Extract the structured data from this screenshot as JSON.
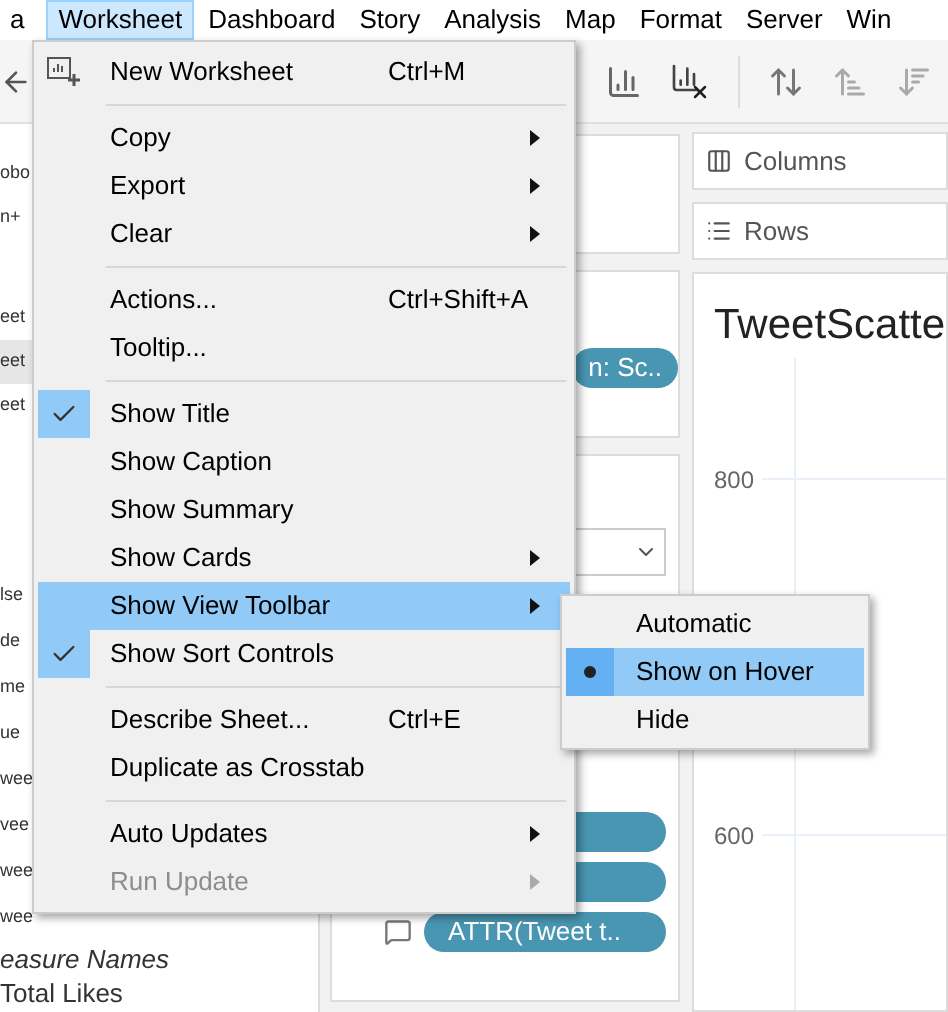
{
  "menubar": [
    {
      "label": "a",
      "selected": false
    },
    {
      "label": "Worksheet",
      "selected": true
    },
    {
      "label": "Dashboard",
      "selected": false
    },
    {
      "label": "Story",
      "selected": false
    },
    {
      "label": "Analysis",
      "selected": false
    },
    {
      "label": "Map",
      "selected": false
    },
    {
      "label": "Format",
      "selected": false
    },
    {
      "label": "Server",
      "selected": false
    },
    {
      "label": "Win",
      "selected": false
    }
  ],
  "data_pane": {
    "items_top": [
      {
        "label": "obo",
        "selected": false
      },
      {
        "label": "n+",
        "selected": false
      },
      {
        "label": "eet",
        "selected": false
      },
      {
        "label": "eet",
        "selected": true
      },
      {
        "label": "eet",
        "selected": false
      }
    ],
    "fields": [
      "lse",
      "de",
      "me",
      "ue",
      "wee",
      "vee",
      "wee",
      "wee"
    ],
    "fields_below": [
      {
        "label": "easure Names",
        "italic": true
      },
      {
        "label": "Total Likes",
        "italic": false
      }
    ]
  },
  "cards": {
    "filter_pill": "n: Sc..",
    "marks_pills": [
      {
        "kind": "plain"
      },
      {
        "kind": "plain"
      },
      {
        "label": "ATTR(Tweet t..",
        "kind": "tooltip"
      }
    ]
  },
  "shelves": [
    {
      "label": "Columns",
      "kind": "columns"
    },
    {
      "label": "Rows",
      "kind": "rows"
    }
  ],
  "view": {
    "title": "TweetScatte",
    "yticks": [
      "800",
      "600"
    ]
  },
  "menu": {
    "sections": [
      [
        {
          "label": "New Worksheet",
          "shortcut": "Ctrl+M",
          "submenu": false,
          "checked": false,
          "selected": false,
          "disabled": false,
          "kind": "new"
        }
      ],
      [
        {
          "label": "Copy",
          "submenu": true,
          "checked": false,
          "selected": false,
          "disabled": false
        },
        {
          "label": "Export",
          "submenu": true,
          "checked": false,
          "selected": false,
          "disabled": false
        },
        {
          "label": "Clear",
          "submenu": true,
          "checked": false,
          "selected": false,
          "disabled": false
        }
      ],
      [
        {
          "label": "Actions...",
          "shortcut": "Ctrl+Shift+A",
          "submenu": false,
          "checked": false,
          "selected": false,
          "disabled": false
        },
        {
          "label": "Tooltip...",
          "submenu": false,
          "checked": false,
          "selected": false,
          "disabled": false
        }
      ],
      [
        {
          "label": "Show Title",
          "submenu": false,
          "checked": true,
          "selected": false,
          "disabled": false
        },
        {
          "label": "Show Caption",
          "submenu": false,
          "checked": false,
          "selected": false,
          "disabled": false
        },
        {
          "label": "Show Summary",
          "submenu": false,
          "checked": false,
          "selected": false,
          "disabled": false
        },
        {
          "label": "Show Cards",
          "submenu": true,
          "checked": false,
          "selected": false,
          "disabled": false
        },
        {
          "label": "Show View Toolbar",
          "submenu": true,
          "checked": false,
          "selected": true,
          "disabled": false
        },
        {
          "label": "Show Sort Controls",
          "submenu": false,
          "checked": true,
          "selected": false,
          "disabled": false
        }
      ],
      [
        {
          "label": "Describe Sheet...",
          "shortcut": "Ctrl+E",
          "submenu": false,
          "checked": false,
          "selected": false,
          "disabled": false
        },
        {
          "label": "Duplicate as Crosstab",
          "submenu": false,
          "checked": false,
          "selected": false,
          "disabled": false
        }
      ],
      [
        {
          "label": "Auto Updates",
          "submenu": true,
          "checked": false,
          "selected": false,
          "disabled": false
        },
        {
          "label": "Run Update",
          "submenu": true,
          "checked": false,
          "selected": false,
          "disabled": true
        }
      ]
    ]
  },
  "submenu": [
    {
      "label": "Automatic",
      "selected": false,
      "highlighted": false
    },
    {
      "label": "Show on Hover",
      "selected": true,
      "highlighted": true
    },
    {
      "label": "Hide",
      "selected": false,
      "highlighted": false
    }
  ]
}
